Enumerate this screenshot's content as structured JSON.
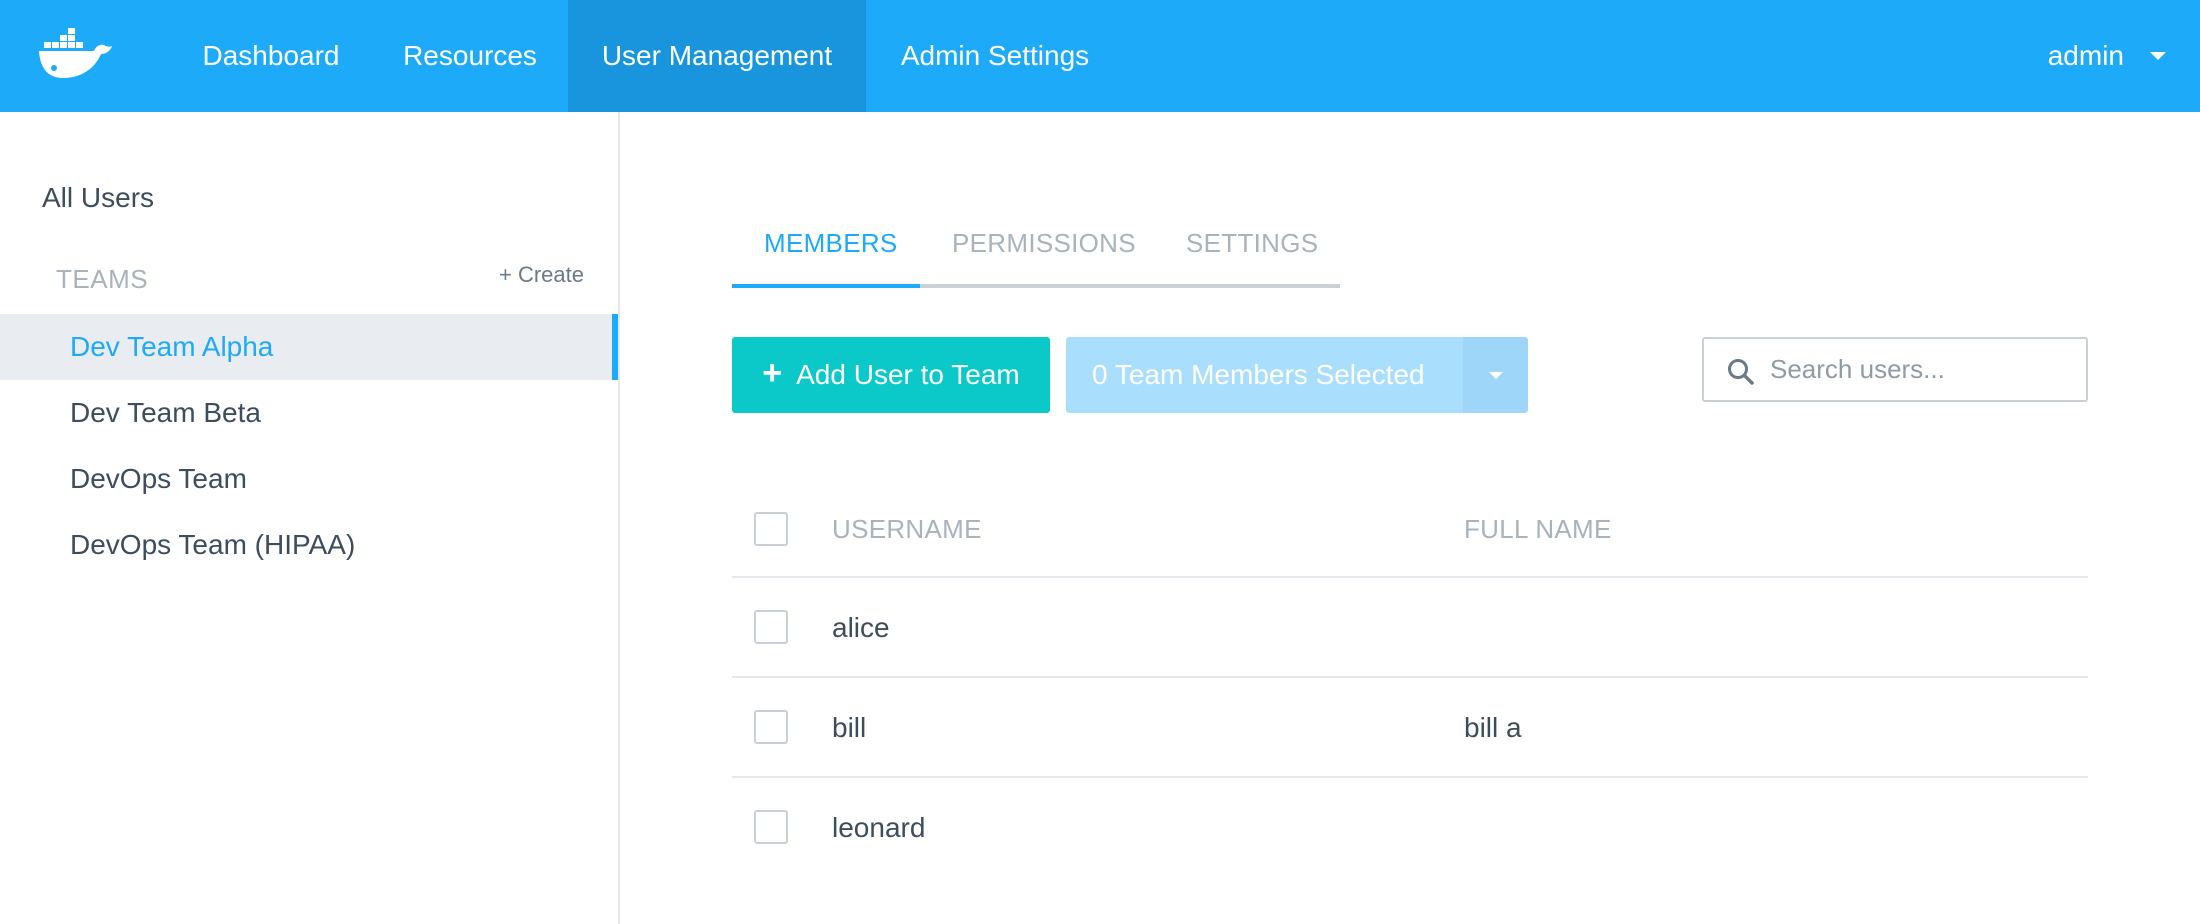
{
  "nav": {
    "logo_icon": "docker-whale-icon",
    "items": [
      {
        "label": "Dashboard"
      },
      {
        "label": "Resources"
      },
      {
        "label": "User Management"
      },
      {
        "label": "Admin Settings"
      }
    ],
    "active": "User Management",
    "user": {
      "name": "admin",
      "icon": "chevron-down-icon"
    }
  },
  "sidebar": {
    "all_users": "All Users",
    "teams_label": "TEAMS",
    "create_label": "+ Create",
    "teams": [
      {
        "label": "Dev Team Alpha"
      },
      {
        "label": "Dev Team Beta"
      },
      {
        "label": "DevOps Team"
      },
      {
        "label": "DevOps Team (HIPAA)"
      }
    ],
    "active_team": "Dev Team Alpha"
  },
  "tabs": [
    {
      "label": "MEMBERS"
    },
    {
      "label": "PERMISSIONS"
    },
    {
      "label": "SETTINGS"
    }
  ],
  "active_tab": "MEMBERS",
  "actions": {
    "add_user_label": "Add User to Team",
    "selected_label": "0 Team Members Selected",
    "search_placeholder": "Search users..."
  },
  "table": {
    "columns": {
      "username": "USERNAME",
      "full_name": "FULL NAME"
    },
    "rows": [
      {
        "username": "alice",
        "full_name": ""
      },
      {
        "username": "bill",
        "full_name": "bill a"
      },
      {
        "username": "leonard",
        "full_name": ""
      }
    ]
  },
  "colors": {
    "brand": "#1daaf9",
    "nav_active": "#1895dc",
    "add_button": "#0cc9c9",
    "selected_button": "#a9defc"
  }
}
